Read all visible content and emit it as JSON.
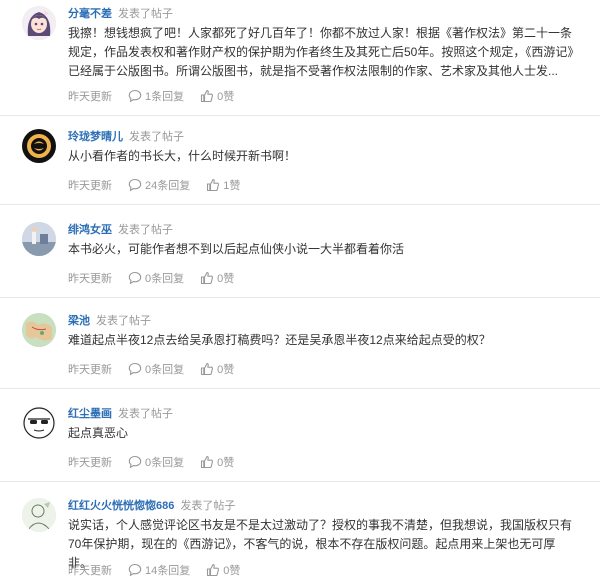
{
  "posts": [
    {
      "author": "分毫不差",
      "action": "发表了帖子",
      "content": "我擦！想钱想疯了吧！人家都死了好几百年了！你都不放过人家！根据《著作权法》第二十一条规定，作品发表权和著作财产权的保护期为作者终生及其死亡后50年。按照这个规定，《西游记》已经属于公版图书。所谓公版图书，就是指不受著作权法限制的作家、艺术家及其他人士发...",
      "time": "昨天更新",
      "replies": "1条回复",
      "likes": "0赞",
      "avatar_icon": "anime-girl-avatar"
    },
    {
      "author": "玲珑梦晴儿",
      "action": "发表了帖子",
      "content": "从小看作者的书长大，什么时候开新书啊！",
      "time": "昨天更新",
      "replies": "24条回复",
      "likes": "1赞",
      "avatar_icon": "ring-logo-avatar"
    },
    {
      "author": "绯鸿女巫",
      "action": "发表了帖子",
      "content": "本书必火，可能作者想不到以后起点仙侠小说一大半都看着你活",
      "time": "昨天更新",
      "replies": "0条回复",
      "likes": "0赞",
      "avatar_icon": "photo-avatar"
    },
    {
      "author": "梁池",
      "action": "发表了帖子",
      "content": "难道起点半夜12点去给吴承恩打稿费吗？还是吴承恩半夜12点来给起点受的权？",
      "time": "昨天更新",
      "replies": "0条回复",
      "likes": "0赞",
      "avatar_icon": "map-avatar"
    },
    {
      "author": "红尘墨画",
      "action": "发表了帖子",
      "content": "起点真恶心",
      "time": "昨天更新",
      "replies": "0条回复",
      "likes": "0赞",
      "avatar_icon": "sunglasses-face-avatar"
    },
    {
      "author": "红红火火恍恍惚惚686",
      "action": "发表了帖子",
      "content": "说实话，个人感觉评论区书友是不是太过激动了？授权的事我不清楚，但我想说，我国版权只有70年保护期，现在的《西游记》，不客气的说，根本不存在版权问题。起点用来上架也无可厚非。",
      "time": "昨天更新",
      "replies": "14条回复",
      "likes": "0赞",
      "avatar_icon": "sketch-avatar"
    }
  ],
  "colors": {
    "author": "#2d6fb6",
    "meta": "#999999",
    "text": "#333333",
    "divider": "#e8e8e8"
  }
}
